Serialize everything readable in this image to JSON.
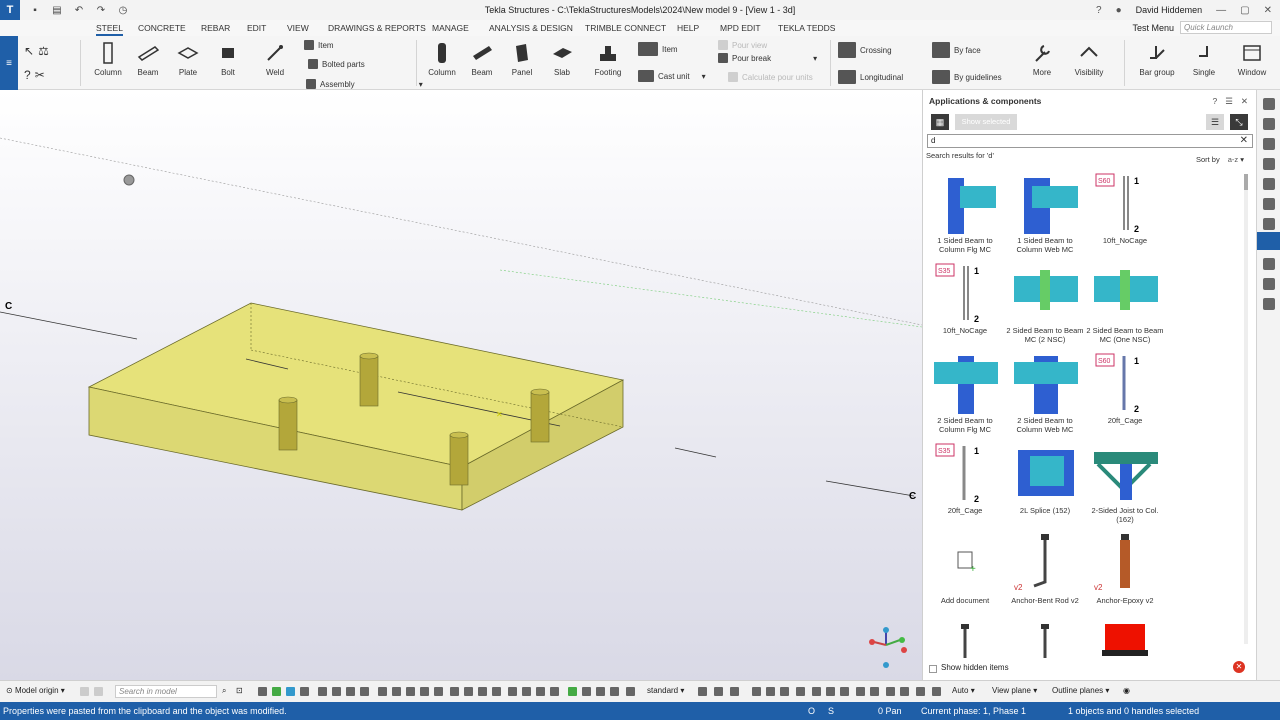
{
  "window": {
    "title": "Tekla Structures - C:\\TeklaStructuresModels\\2024\\New model 9 - [View 1 - 3d]",
    "user": "David Hiddemen"
  },
  "menu_tabs": [
    "STEEL",
    "CONCRETE",
    "REBAR",
    "EDIT",
    "VIEW",
    "DRAWINGS & REPORTS",
    "MANAGE",
    "ANALYSIS & DESIGN",
    "TRIMBLE CONNECT",
    "HELP",
    "MPD EDIT",
    "TEKLA TEDDS"
  ],
  "test_menu": "Test Menu",
  "quick_launch": {
    "placeholder": "Quick Launch"
  },
  "ribbon": {
    "steel": {
      "column": "Column",
      "beam": "Beam",
      "plate": "Plate",
      "bolt": "Bolt",
      "weld": "Weld",
      "item": "Item",
      "bolted_parts": "Bolted parts",
      "assembly": "Assembly"
    },
    "concrete": {
      "column": "Column",
      "beam": "Beam",
      "panel": "Panel",
      "slab": "Slab",
      "footing": "Footing",
      "item": "Item",
      "cast_unit": "Cast unit",
      "pour_view": "Pour view",
      "pour_break": "Pour break",
      "calc_pour_units": "Calculate pour units"
    },
    "rebar": {
      "crossing": "Crossing",
      "longitudinal": "Longitudinal",
      "by_face": "By face",
      "by_guidelines": "By guidelines",
      "more": "More",
      "visibility": "Visibility",
      "bar_group": "Bar group",
      "single": "Single",
      "window": "Window"
    }
  },
  "viewport": {
    "grid_labels": [
      "C",
      "C"
    ],
    "colors": {
      "slab": "#e6e27a",
      "column": "#b3a73a"
    }
  },
  "panel": {
    "title": "Applications & components",
    "show_selected": "Show selected",
    "search_value": "d",
    "results_label": "Search results for 'd'",
    "sort_label": "Sort by",
    "sort_value": "a-z",
    "show_hidden": "Show hidden items",
    "items": [
      {
        "label": "1 Sided Beam to Column Flg MC"
      },
      {
        "label": "1 Sided Beam to Column Web MC"
      },
      {
        "label": "10ft_NoCage",
        "badge": "S60"
      },
      {
        "label": "10ft_NoCage",
        "badge": "S35"
      },
      {
        "label": "2 Sided Beam to Beam MC (2 NSC)"
      },
      {
        "label": "2 Sided Beam to Beam MC (One NSC)"
      },
      {
        "label": "2 Sided Beam to Column Flg MC"
      },
      {
        "label": "2 Sided Beam to Column Web MC"
      },
      {
        "label": "20ft_Cage",
        "badge": "S60"
      },
      {
        "label": "20ft_Cage",
        "badge": "S35"
      },
      {
        "label": "2L Splice (152)"
      },
      {
        "label": "2-Sided Joist to Col. (162)"
      },
      {
        "label": "Add document"
      },
      {
        "label": "Anchor-Bent Rod v2",
        "tag": "v2"
      },
      {
        "label": "Anchor-Epoxy v2",
        "tag": "v2"
      }
    ]
  },
  "bottombar": {
    "model_origin": "Model origin",
    "search_placeholder": "Search in model",
    "standard": "standard",
    "auto": "Auto",
    "view_plane": "View plane",
    "outline_planes": "Outline planes"
  },
  "status": {
    "message": "Properties were pasted from the clipboard and the object was modified.",
    "o": "O",
    "s": "S",
    "pan": "0 Pan",
    "phase": "Current phase: 1, Phase 1",
    "selected": "1 objects and 0 handles selected"
  }
}
